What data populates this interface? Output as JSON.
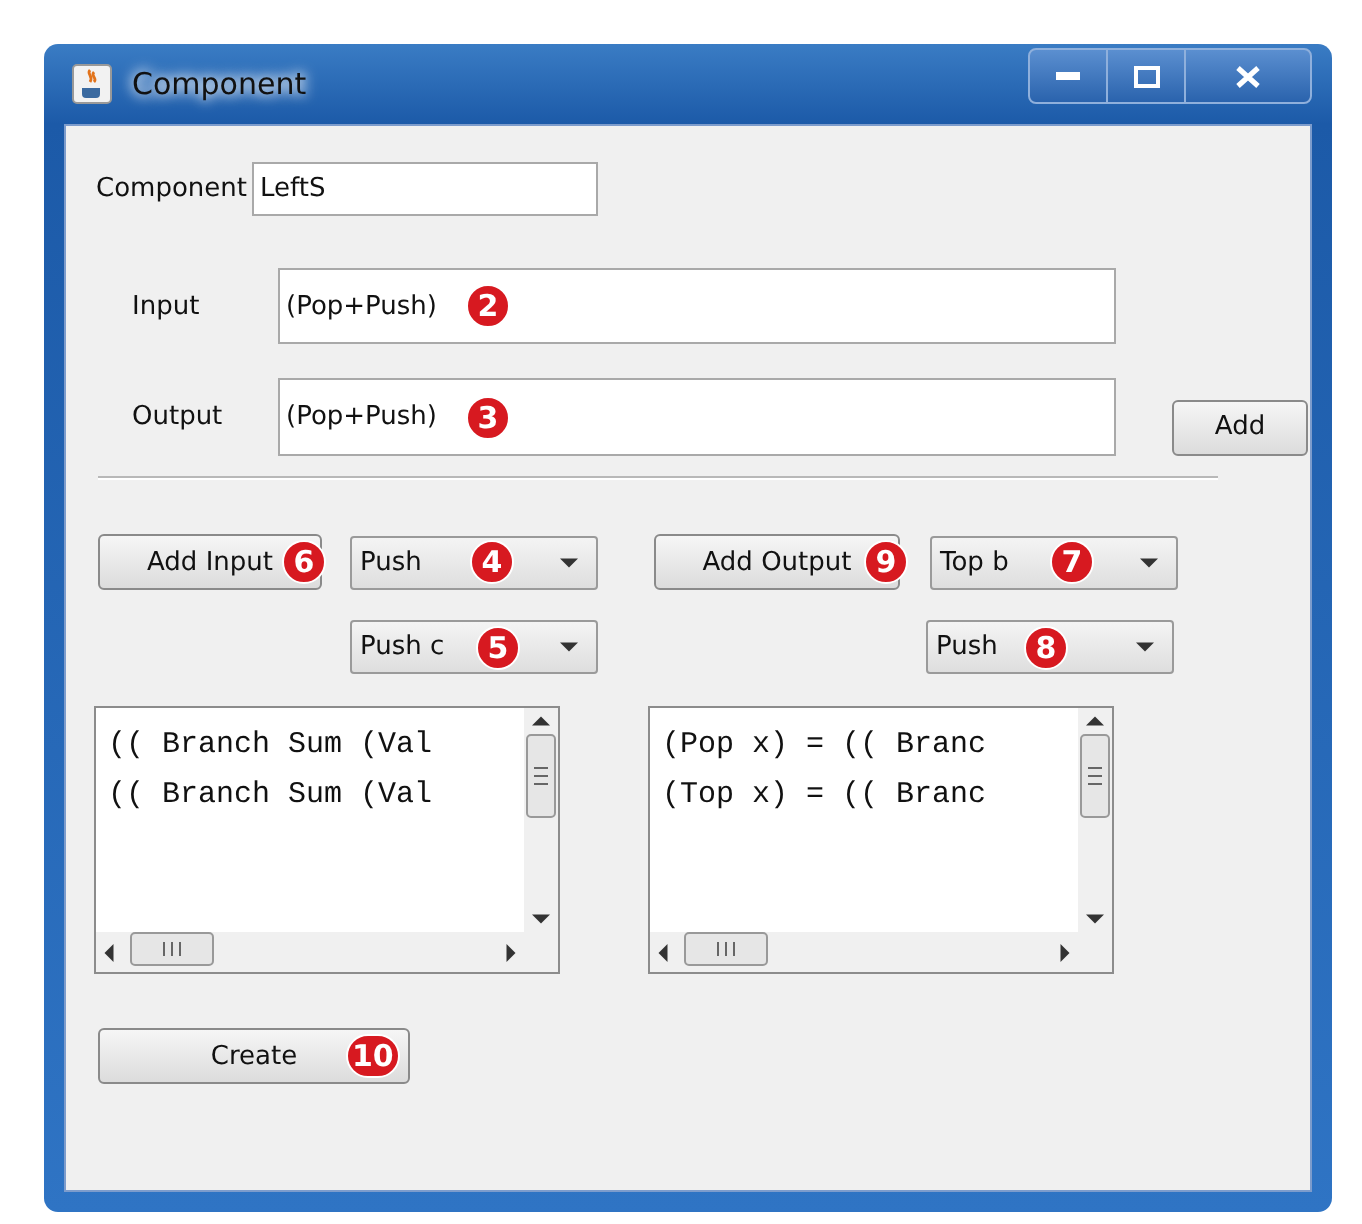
{
  "window": {
    "title": "Component"
  },
  "component": {
    "label": "Component",
    "value": "LeftS"
  },
  "input": {
    "label": "Input",
    "value": "(Pop+Push)",
    "badge": "2"
  },
  "output": {
    "label": "Output",
    "value": "(Pop+Push)",
    "badge": "3"
  },
  "add_button": {
    "label": "Add"
  },
  "input_section": {
    "button": {
      "label": "Add Input",
      "badge": "6"
    },
    "combos": [
      {
        "value": "Push",
        "badge": "4"
      },
      {
        "value": "Push c",
        "badge": "5"
      }
    ],
    "list": [
      "(( Branch Sum (Val",
      "(( Branch Sum (Val"
    ]
  },
  "output_section": {
    "button": {
      "label": "Add Output",
      "badge": "9"
    },
    "combos": [
      {
        "value": "Top b",
        "badge": "7"
      },
      {
        "value": "Push",
        "badge": "8"
      }
    ],
    "list": [
      "(Pop x) = (( Branc",
      "(Top x) = (( Branc"
    ]
  },
  "create_button": {
    "label": "Create",
    "badge": "10"
  }
}
